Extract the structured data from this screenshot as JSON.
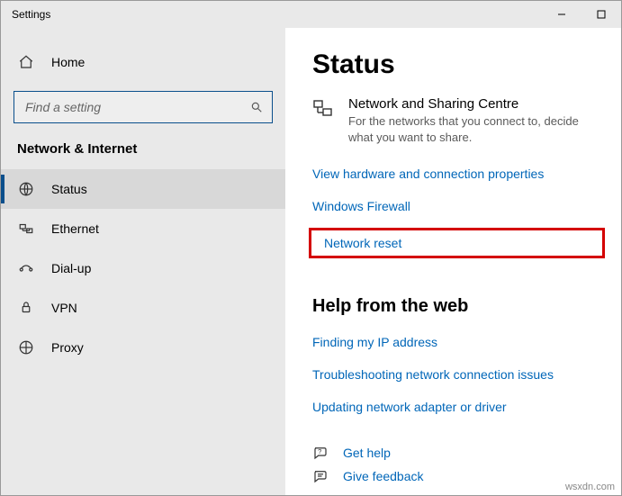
{
  "titlebar": {
    "title": "Settings"
  },
  "sidebar": {
    "home_label": "Home",
    "search_placeholder": "Find a setting",
    "category_label": "Network & Internet",
    "items": [
      {
        "label": "Status"
      },
      {
        "label": "Ethernet"
      },
      {
        "label": "Dial-up"
      },
      {
        "label": "VPN"
      },
      {
        "label": "Proxy"
      }
    ]
  },
  "content": {
    "page_title": "Status",
    "network_sharing": {
      "heading": "Network and Sharing Centre",
      "description": "For the networks that you connect to, decide what you want to share."
    },
    "links": {
      "view_hardware": "View hardware and connection properties",
      "windows_firewall": "Windows Firewall",
      "network_reset": "Network reset"
    },
    "help_section": {
      "heading": "Help from the web",
      "finding_ip": "Finding my IP address",
      "troubleshooting": "Troubleshooting network connection issues",
      "updating_adapter": "Updating network adapter or driver"
    },
    "bottom": {
      "get_help": "Get help",
      "give_feedback": "Give feedback"
    }
  },
  "watermark": "wsxdn.com"
}
